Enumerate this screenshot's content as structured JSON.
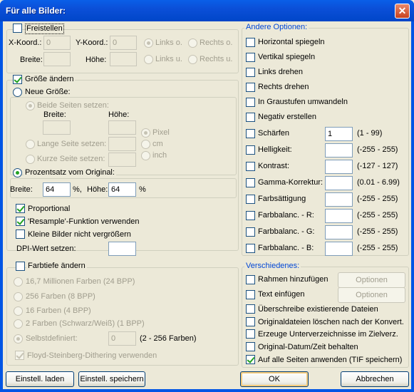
{
  "title": "Für alle Bilder:",
  "close_label": "✕",
  "crop": {
    "checkbox": "Freistellen",
    "xlabel": "X-Koord.:",
    "ylabel": "Y-Koord.:",
    "xvalue": "0",
    "yvalue": "0",
    "width_label": "Breite:",
    "height_label": "Höhe:",
    "pos": [
      "Links o.",
      "Rechts o.",
      "Links u.",
      "Rechts u."
    ]
  },
  "resize": {
    "checkbox": "Größe ändern",
    "newsize": "Neue Größe:",
    "both": "Beide Seiten setzen:",
    "width": "Breite:",
    "height": "Höhe:",
    "long": "Lange Seite setzen:",
    "short": "Kurze Seite setzen:",
    "units": [
      "Pixel",
      "cm",
      "inch"
    ],
    "percent": "Prozentsatz vom Original:",
    "pwidth_label": "Breite:",
    "pwidth": "64",
    "pct1": "%,",
    "pheight_label": "Höhe:",
    "pheight": "64",
    "pct2": "%",
    "proportional": "Proportional",
    "resample": "'Resample'-Funktion verwenden",
    "noenlarge": "Kleine Bilder nicht vergrößern",
    "dpi": "DPI-Wert setzen:"
  },
  "colors": {
    "checkbox": "Farbtiefe ändern",
    "options": [
      "16,7 Millionen Farben (24 BPP)",
      "256 Farben (8 BPP)",
      "16 Farben (4 BPP)",
      "2 Farben (Schwarz/Weiß) (1 BPP)",
      "Selbstdefiniert:"
    ],
    "custom_value": "0",
    "custom_range": "(2 - 256 Farben)",
    "dither": "Floyd-Steinberg-Dithering verwenden"
  },
  "other": {
    "title": "Andere Optionen:",
    "flip_h": "Horizontal spiegeln",
    "flip_v": "Vertikal spiegeln",
    "rot_l": "Links drehen",
    "rot_r": "Rechts drehen",
    "gray": "In Graustufen umwandeln",
    "neg": "Negativ erstellen",
    "sliders": [
      {
        "label": "Schärfen",
        "value": "1",
        "range": "(1  -  99)"
      },
      {
        "label": "Helligkeit:",
        "value": "",
        "range": "(-255  -  255)"
      },
      {
        "label": "Kontrast:",
        "value": "",
        "range": "(-127  -  127)"
      },
      {
        "label": "Gamma-Korrektur:",
        "value": "",
        "range": "(0.01  -  6.99)"
      },
      {
        "label": "Farbsättigung",
        "value": "",
        "range": "(-255  -  255)"
      },
      {
        "label": "Farbbalanc. - R:",
        "value": "",
        "range": "(-255  -  255)"
      },
      {
        "label": "Farbbalanc. - G:",
        "value": "",
        "range": "(-255  -  255)"
      },
      {
        "label": "Farbbalanc. - B:",
        "value": "",
        "range": "(-255  -  255)"
      }
    ]
  },
  "misc": {
    "title": "Verschiedenes:",
    "frame": "Rahmen hinzufügen",
    "text": "Text einfügen",
    "options_btn": "Optionen",
    "overwrite": "Überschreibe existierende Dateien",
    "delete": "Originaldateien löschen nach der Konvert.",
    "subdirs": "Erzeuge Unterverzeichnisse im Zielverz.",
    "keepdate": "Original-Datum/Zeit behalten",
    "allpages": "Auf alle Seiten anwenden (TIF speichern)"
  },
  "buttons": {
    "load": "Einstell. laden",
    "save": "Einstell. speichern",
    "ok": "OK",
    "cancel": "Abbrechen"
  }
}
